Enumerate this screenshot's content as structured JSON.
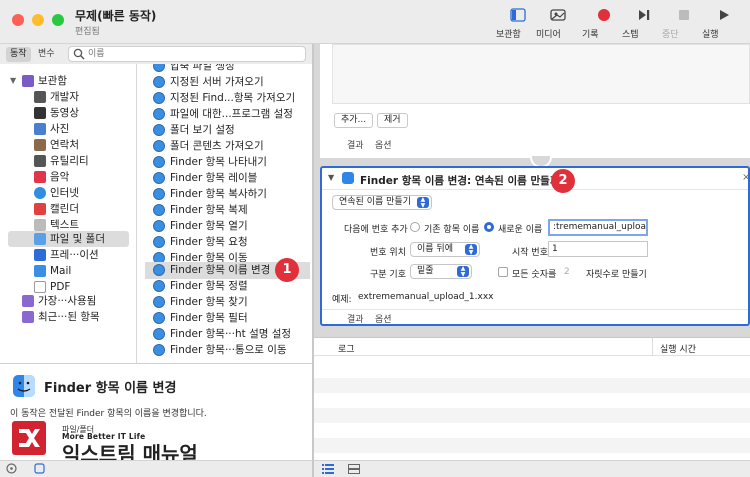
{
  "window": {
    "title": "무제(빠른 동작)",
    "subtitle": "편집됨"
  },
  "toolbar": {
    "library": "보관함",
    "media": "미디어",
    "record": "기록",
    "step": "스텝",
    "stop": "중단",
    "run": "실행"
  },
  "library": {
    "tab_actions": "동작",
    "tab_variables": "변수",
    "search_placeholder": "이름",
    "categories": [
      {
        "label": "보관함",
        "icon": "library-icon",
        "color": "#7a5cc4"
      },
      {
        "label": "개발자",
        "icon": "tools-icon",
        "color": "#555555"
      },
      {
        "label": "동영상",
        "icon": "movie-icon",
        "color": "#333333"
      },
      {
        "label": "사진",
        "icon": "photo-icon",
        "color": "#4a7fd0"
      },
      {
        "label": "연락처",
        "icon": "contacts-icon",
        "color": "#8a6a4a"
      },
      {
        "label": "유틸리티",
        "icon": "utility-icon",
        "color": "#555555"
      },
      {
        "label": "음악",
        "icon": "music-icon",
        "color": "#e0354a"
      },
      {
        "label": "인터넷",
        "icon": "internet-icon",
        "color": "#2f8ee0"
      },
      {
        "label": "캘린더",
        "icon": "calendar-icon",
        "color": "#e04040"
      },
      {
        "label": "텍스트",
        "icon": "text-icon",
        "color": "#999999"
      },
      {
        "label": "파일 및 폴더",
        "icon": "folder-icon",
        "color": "#5aa0e6"
      },
      {
        "label": "프레···이션",
        "icon": "presentation-icon",
        "color": "#2f6bd8"
      },
      {
        "label": "Mail",
        "icon": "mail-icon",
        "color": "#3b8ee6"
      },
      {
        "label": "PDF",
        "icon": "pdf-icon",
        "color": "#888888"
      },
      {
        "label": "가장···사용됨",
        "icon": "smart-folder-icon",
        "color": "#8a68d0"
      },
      {
        "label": "최근···된 항목",
        "icon": "smart-folder-icon",
        "color": "#8a68d0"
      }
    ],
    "actions": [
      "압축 파일 생성",
      "지정된 서버 가져오기",
      "지정된 Find...항목 가져오기",
      "파일에 대한...프로그램 설정",
      "폴더 보기 설정",
      "폴더 콘텐츠 가져오기",
      "Finder 항목 나타내기",
      "Finder 항목 레이블",
      "Finder 항목 복사하기",
      "Finder 항목 복제",
      "Finder 항목 열기",
      "Finder 항목 요청",
      "Finder 항목 이동",
      "Finder 항목 이름 변경",
      "Finder 항목 정렬",
      "Finder 항목 찾기",
      "Finder 항목 필터",
      "Finder 항목···ht 설명 설정",
      "Finder 항목···통으로 이동"
    ],
    "badge1": "1"
  },
  "description": {
    "title": "Finder 항목 이름 변경",
    "text": "이 동작은 전달된 Finder 항목의 이름을 변경합니다.",
    "sub": "파일/폴더"
  },
  "watermark": {
    "small": "More Better IT Life",
    "big": "익스트림 매뉴얼"
  },
  "prev_action": {
    "add": "추가...",
    "remove": "제거",
    "results": "결과",
    "options": "옵션"
  },
  "rename_action": {
    "title": "Finder 항목 이름 변경: 연속된 이름 만들기",
    "mode": "연속된 이름 만들기",
    "add_number_to": "다음에 번호 추가",
    "existing_name": "기존 항목 이름",
    "new_name": "새로운 이름",
    "new_name_value": ":trememanual_upload",
    "number_position": "번호 위치",
    "position_value": "이름 뒤에",
    "start_number": "시작 번호",
    "start_number_value": "1",
    "separator": "구분 기호",
    "separator_value": "밑줄",
    "all_digits": "모든 숫자를",
    "digits_value": "2",
    "digits_suffix": "자릿수로 만들기",
    "example_label": "예제:",
    "example_value": "extrememanual_upload_1.xxx",
    "results": "결과",
    "options": "옵션",
    "badge2": "2"
  },
  "log": {
    "col_log": "로그",
    "col_time": "실행 시간"
  }
}
